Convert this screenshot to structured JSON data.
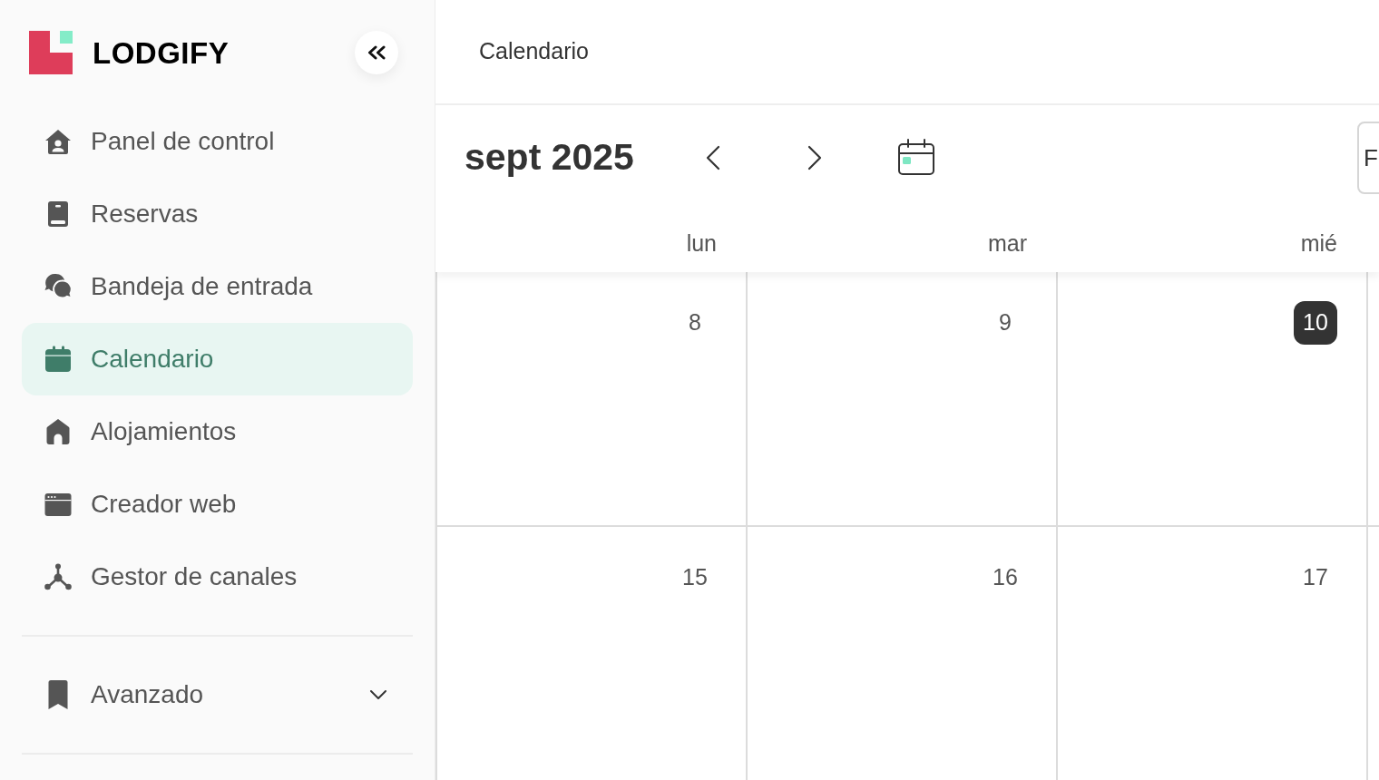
{
  "sidebar": {
    "brand": "LODGIFY",
    "items": [
      {
        "label": "Panel de control",
        "selected": false
      },
      {
        "label": "Reservas",
        "selected": false
      },
      {
        "label": "Bandeja de entrada",
        "selected": false
      },
      {
        "label": "Calendario",
        "selected": true
      },
      {
        "label": "Alojamientos",
        "selected": false
      },
      {
        "label": "Creador web",
        "selected": false
      },
      {
        "label": "Gestor de canales",
        "selected": false
      }
    ],
    "advanced": {
      "label": "Avanzado",
      "expanded": false
    }
  },
  "header": {
    "title": "Calendario"
  },
  "toolbar": {
    "month": "sept 2025",
    "right_button": {
      "label": "F"
    }
  },
  "calendar": {
    "weekdays": [
      "lun",
      "mar",
      "mié"
    ],
    "weeks": [
      {
        "days": [
          {
            "day": "8",
            "today": false
          },
          {
            "day": "9",
            "today": false
          },
          {
            "day": "10",
            "today": true
          }
        ]
      },
      {
        "days": [
          {
            "day": "15",
            "today": false
          },
          {
            "day": "16",
            "today": false
          },
          {
            "day": "17",
            "today": false
          }
        ]
      }
    ]
  }
}
